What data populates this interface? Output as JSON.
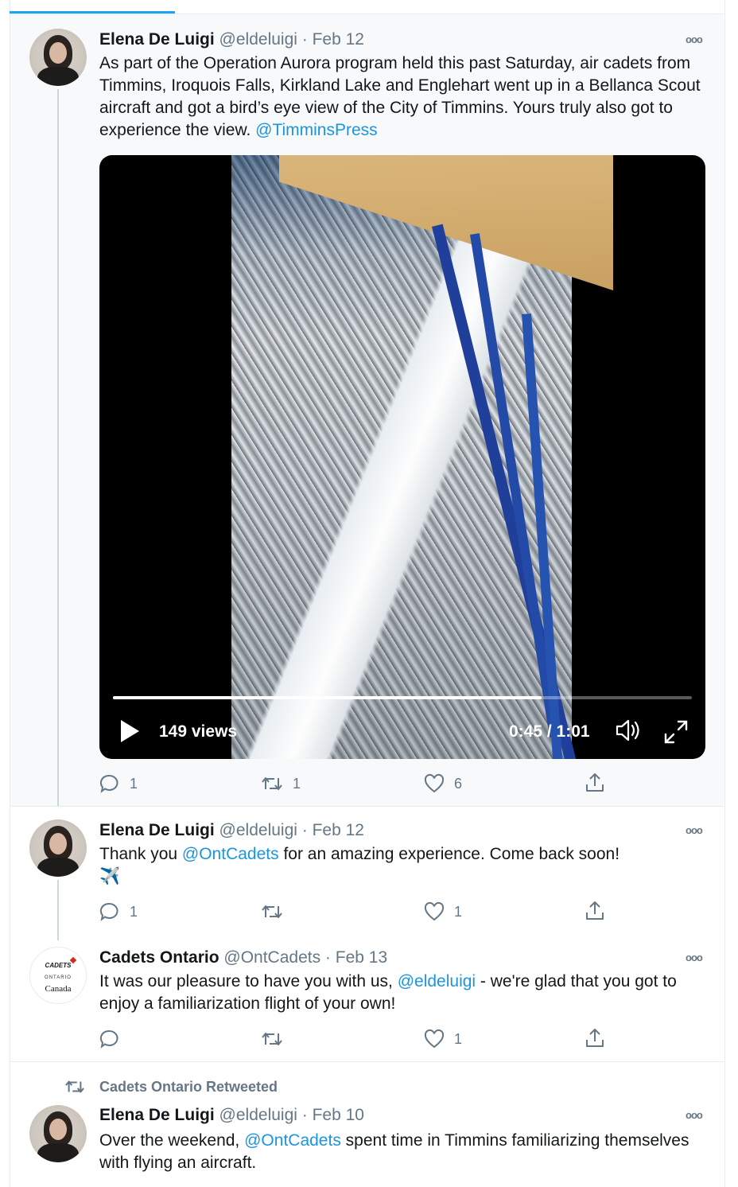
{
  "colors": {
    "link": "#1b95e0",
    "muted": "#657786",
    "text": "#14171a",
    "accent": "#1da1f2"
  },
  "tweets": [
    {
      "name": "Elena De Luigi",
      "meta": "@eldeluigi · Feb 12",
      "text_before": "As part of the Operation Aurora program held this past Saturday, air cadets from Timmins, Iroquois Falls, Kirkland Lake and Englehart went up in a Bellanca Scout aircraft and got a bird’s eye view of the City of Timmins. Yours truly also got to experience the view. ",
      "mention": "@TimminsPress",
      "replies": "1",
      "retweets": "1",
      "likes": "6",
      "video": {
        "views": "149 views",
        "time": "0:45 / 1:01",
        "progress": 0.74
      }
    },
    {
      "name": "Elena De Luigi",
      "meta": "@eldeluigi · Feb 12",
      "text_before": "Thank you ",
      "mention": "@OntCadets",
      "text_after": " for an amazing experience. Come back soon!",
      "emoji": "✈️",
      "replies": "1",
      "retweets": "",
      "likes": "1"
    },
    {
      "name": "Cadets Ontario",
      "meta": "@OntCadets · Feb 13",
      "text_before": "It was our pleasure to have you with us, ",
      "mention": "@eldeluigi",
      "text_after": " - we're glad that you got to enjoy a familiarization flight of your own!",
      "replies": "",
      "retweets": "",
      "likes": "1",
      "logo": {
        "top": "CADETS",
        "mid": "ONTARIO",
        "bot": "Canada"
      }
    },
    {
      "retweeted_by": "Cadets Ontario Retweeted",
      "name": "Elena De Luigi",
      "meta": "@eldeluigi · Feb 10",
      "text_before": "Over the weekend, ",
      "mention": "@OntCadets",
      "text_after": " spent time in Timmins familiarizing themselves with flying an aircraft."
    }
  ],
  "more_glyph": "ooo"
}
